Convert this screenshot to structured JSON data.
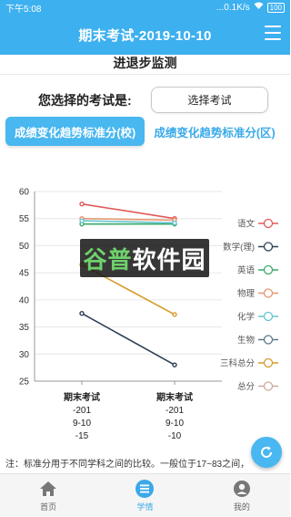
{
  "status": {
    "time": "下午5:08",
    "network": "...0.1K/s",
    "battery": "100"
  },
  "header": {
    "title": "期末考试-2019-10-10",
    "menu_icon": "hamburger-menu-icon"
  },
  "page": {
    "subtitle": "进退步监测",
    "exam_label": "您选择的考试是:",
    "exam_button": "选择考试"
  },
  "tabs": [
    {
      "label": "成绩变化趋势标准分(校)",
      "active": true
    },
    {
      "label": "成绩变化趋势标准分(区)",
      "active": false
    }
  ],
  "chart_data": {
    "type": "line",
    "categories": [
      {
        "name": "期末考试",
        "lines": [
          "-201",
          "9-10",
          "-15"
        ]
      },
      {
        "name": "期末考试",
        "lines": [
          "-201",
          "9-10",
          "-10"
        ]
      }
    ],
    "ylim": [
      25,
      60
    ],
    "yticks": [
      25,
      30,
      35,
      40,
      45,
      50,
      55,
      60
    ],
    "grid": "horizontal",
    "legend_position": "right",
    "series": [
      {
        "name": "语文",
        "color": "#e05a5a",
        "values": [
          57.7,
          55.0
        ]
      },
      {
        "name": "数学(理)",
        "color": "#2e3f55",
        "values": [
          37.5,
          28.0
        ]
      },
      {
        "name": "英语",
        "color": "#3aa96a",
        "values": [
          54.0,
          54.0
        ]
      },
      {
        "name": "物理",
        "color": "#e7956f",
        "values": [
          55.0,
          54.7
        ]
      },
      {
        "name": "化学",
        "color": "#66c4cf",
        "values": [
          54.6,
          54.2
        ]
      },
      {
        "name": "生物",
        "color": "#5b7a8c",
        "values": [
          null,
          null
        ]
      },
      {
        "name": "三科总分",
        "color": "#d69b2b",
        "values": [
          46.5,
          37.3
        ]
      },
      {
        "name": "总分",
        "color": "#cfa99a",
        "values": [
          null,
          null
        ]
      }
    ]
  },
  "note": "注：标准分用于不同学科之间的比较。一般位于17~83之间，",
  "watermark": {
    "prefix": "谷普",
    "suffix": "软件园"
  },
  "bottom_nav": [
    {
      "label": "首页",
      "icon": "home-icon",
      "active": false
    },
    {
      "label": "学情",
      "icon": "list-icon",
      "active": true
    },
    {
      "label": "我的",
      "icon": "user-icon",
      "active": false
    }
  ],
  "fab_icon": "refresh-icon"
}
